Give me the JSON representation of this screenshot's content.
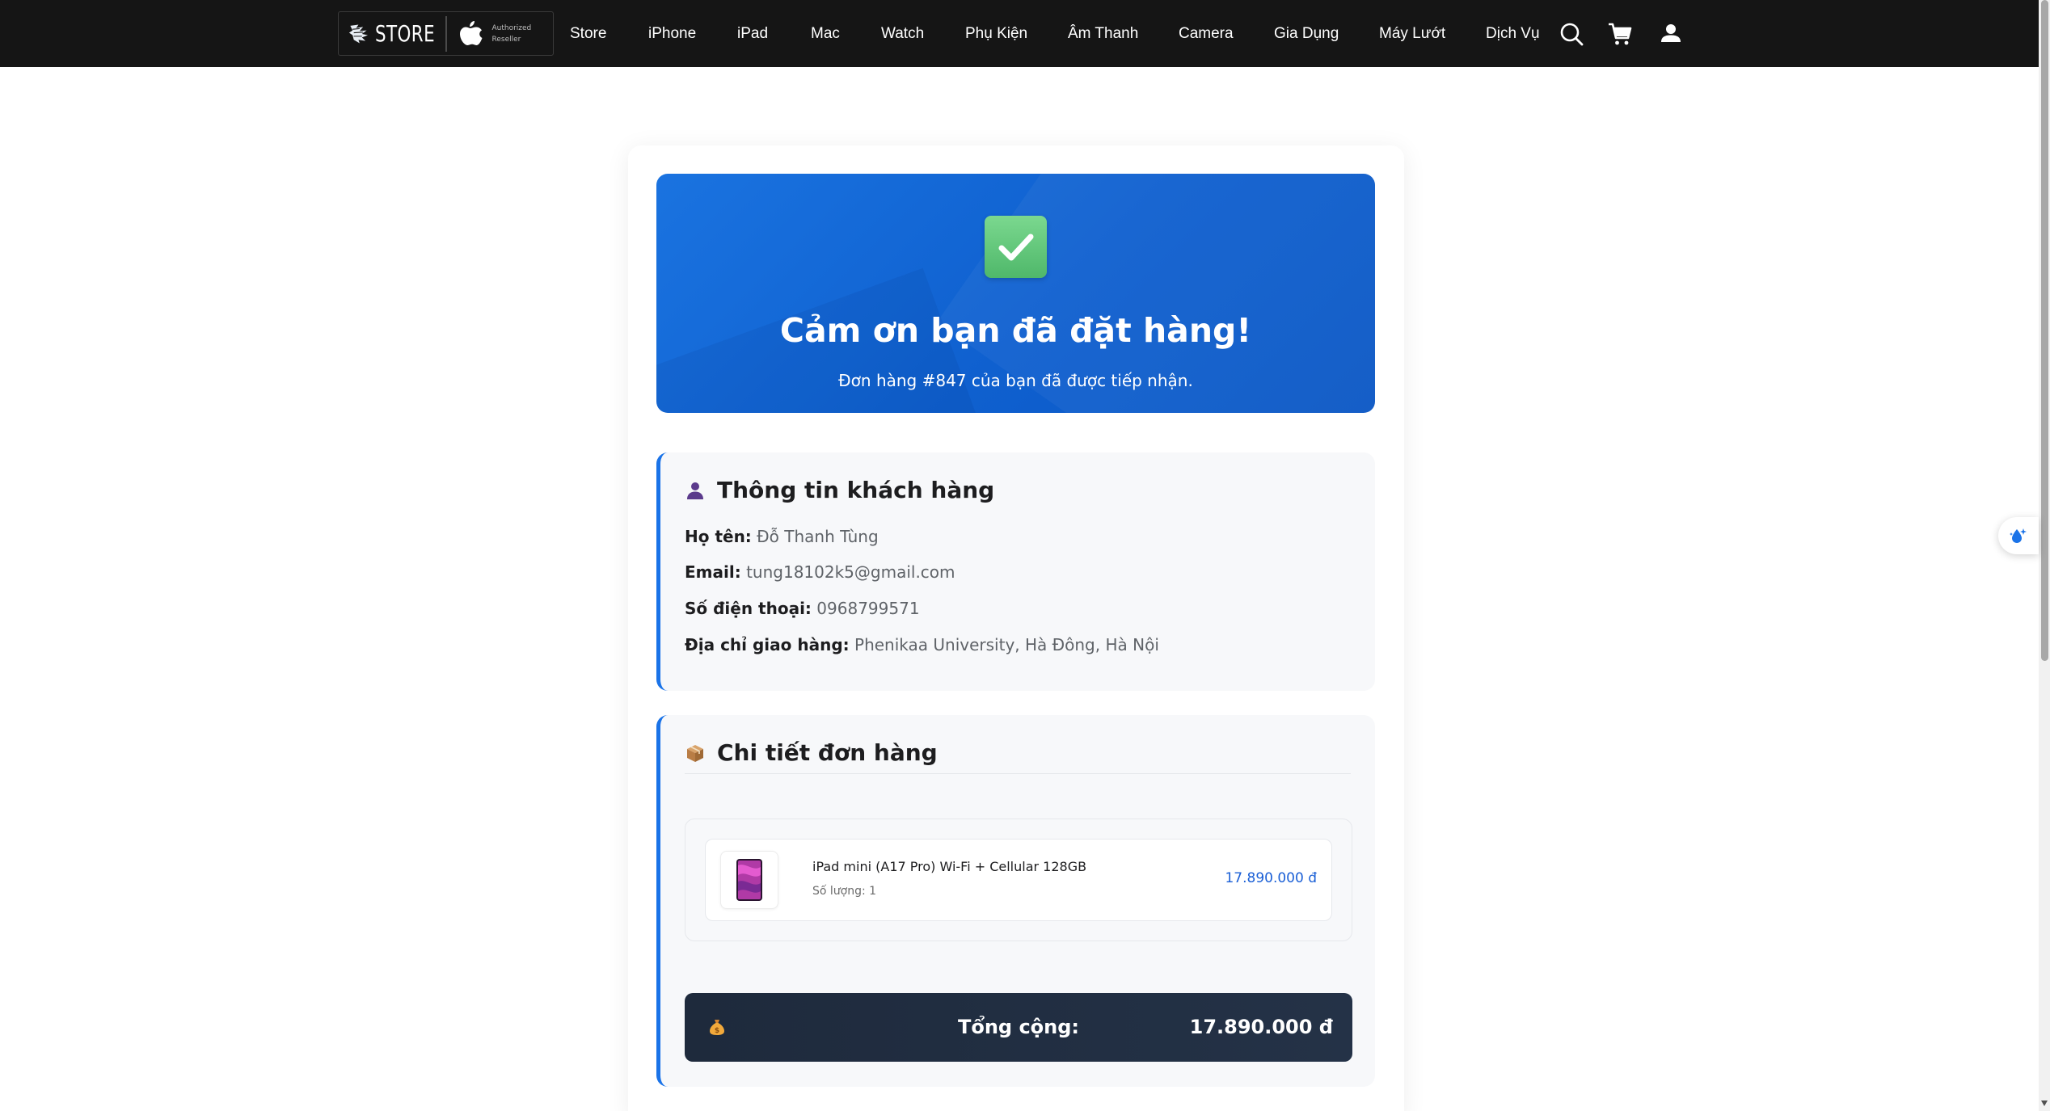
{
  "brand": {
    "store_text": "STORE",
    "reseller_line1": "Authorized",
    "reseller_line2": "Reseller"
  },
  "nav": {
    "items": [
      "Store",
      "iPhone",
      "iPad",
      "Mac",
      "Watch",
      "Phụ Kiện",
      "Âm Thanh",
      "Camera",
      "Gia Dụng",
      "Máy Lướt",
      "Dịch Vụ"
    ],
    "icons": [
      "search-icon",
      "cart-icon",
      "user-icon"
    ]
  },
  "hero": {
    "icon": "check-mark-icon",
    "title": "Cảm ơn bạn đã đặt hàng!",
    "subtitle": "Đơn hàng #847 của bạn đã được tiếp nhận."
  },
  "customer": {
    "icon": "user-icon",
    "title": "Thông tin khách hàng",
    "fields": [
      {
        "label": "Họ tên:",
        "value": "Đỗ Thanh Tùng"
      },
      {
        "label": "Email:",
        "value": "tung18102k5@gmail.com"
      },
      {
        "label": "Số điện thoại:",
        "value": "0968799571"
      },
      {
        "label": "Địa chỉ giao hàng:",
        "value": "Phenikaa University, Hà Đông, Hà Nội"
      }
    ]
  },
  "order": {
    "icon": "package-icon",
    "title": "Chi tiết đơn hàng",
    "items": [
      {
        "name": "iPad mini (A17 Pro) Wi-Fi + Cellular 128GB",
        "quantity": "Số lượng: 1",
        "price": "17.890.000 đ"
      }
    ],
    "total": {
      "icon": "money-bag-icon",
      "label": "Tổng cộng:",
      "value": "17.890.000 đ"
    }
  },
  "colors": {
    "nav_bg": "#151515",
    "hero_blue": "#1a73e0",
    "accent_border": "#1a73e8",
    "price_blue": "#1a5fd6",
    "total_bar": "#1e2a3c",
    "check_green": "#5cc277"
  }
}
